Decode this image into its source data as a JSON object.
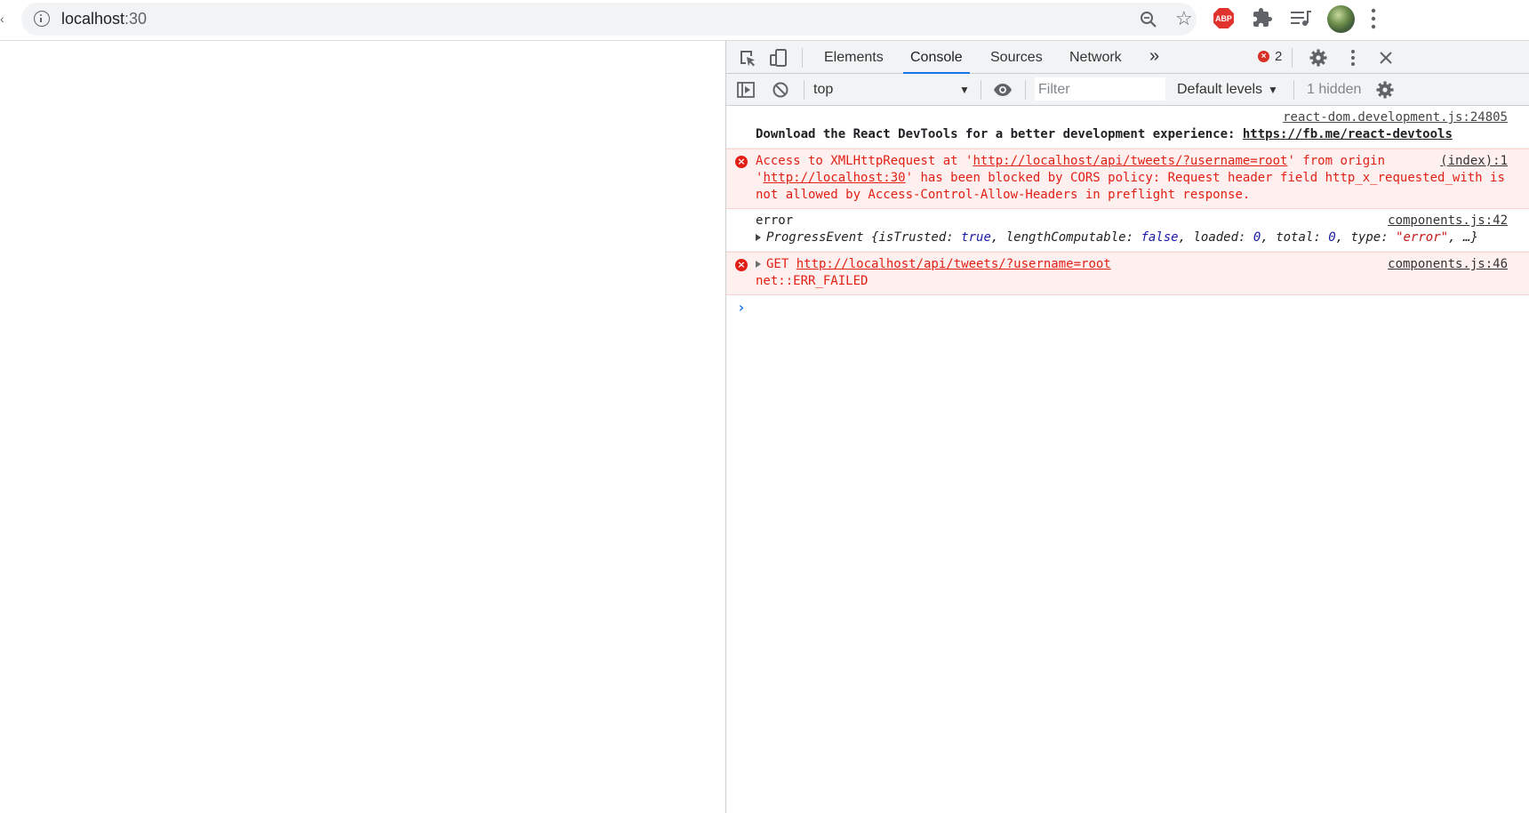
{
  "browser": {
    "url_host": "localhost",
    "url_port": ":30"
  },
  "devtools": {
    "tabs": [
      "Elements",
      "Console",
      "Sources",
      "Network"
    ],
    "active_tab": "Console",
    "more_tabs_label": "»",
    "error_count": "2",
    "context": "top",
    "filter_placeholder": "Filter",
    "levels_label": "Default levels",
    "hidden_label": "1 hidden"
  },
  "console": {
    "msg1": {
      "source": "react-dom.development.js:24805",
      "text": "Download the React DevTools for a better development experience: ",
      "link": "https://fb.me/react-devtools"
    },
    "msg2": {
      "source": "(index):1",
      "t1": "Access to XMLHttpRequest at '",
      "link1": "http://localhost/api/tweets/?username=root",
      "t2": "' from origin '",
      "link2": "http://localhost:30",
      "t3": "' has been blocked by CORS policy: Request header field http_x_requested_with is not allowed by Access-Control-Allow-Headers in preflight response."
    },
    "msg3": {
      "label": "error",
      "source": "components.js:42",
      "obj_name": "ProgressEvent",
      "obj_body": [
        {
          "t": " {isTrusted: "
        },
        {
          "v": "true",
          "c": "kw"
        },
        {
          "t": ", lengthComputable: "
        },
        {
          "v": "false",
          "c": "kw"
        },
        {
          "t": ", loaded: "
        },
        {
          "v": "0",
          "c": "num"
        },
        {
          "t": ", total: "
        },
        {
          "v": "0",
          "c": "num"
        },
        {
          "t": ", type: "
        },
        {
          "v": "\"error\"",
          "c": "str"
        },
        {
          "t": ", …}"
        }
      ]
    },
    "msg4": {
      "source": "components.js:46",
      "method": "GET ",
      "link": "http://localhost/api/tweets/?username=root",
      "suffix": "net::ERR_FAILED"
    }
  }
}
